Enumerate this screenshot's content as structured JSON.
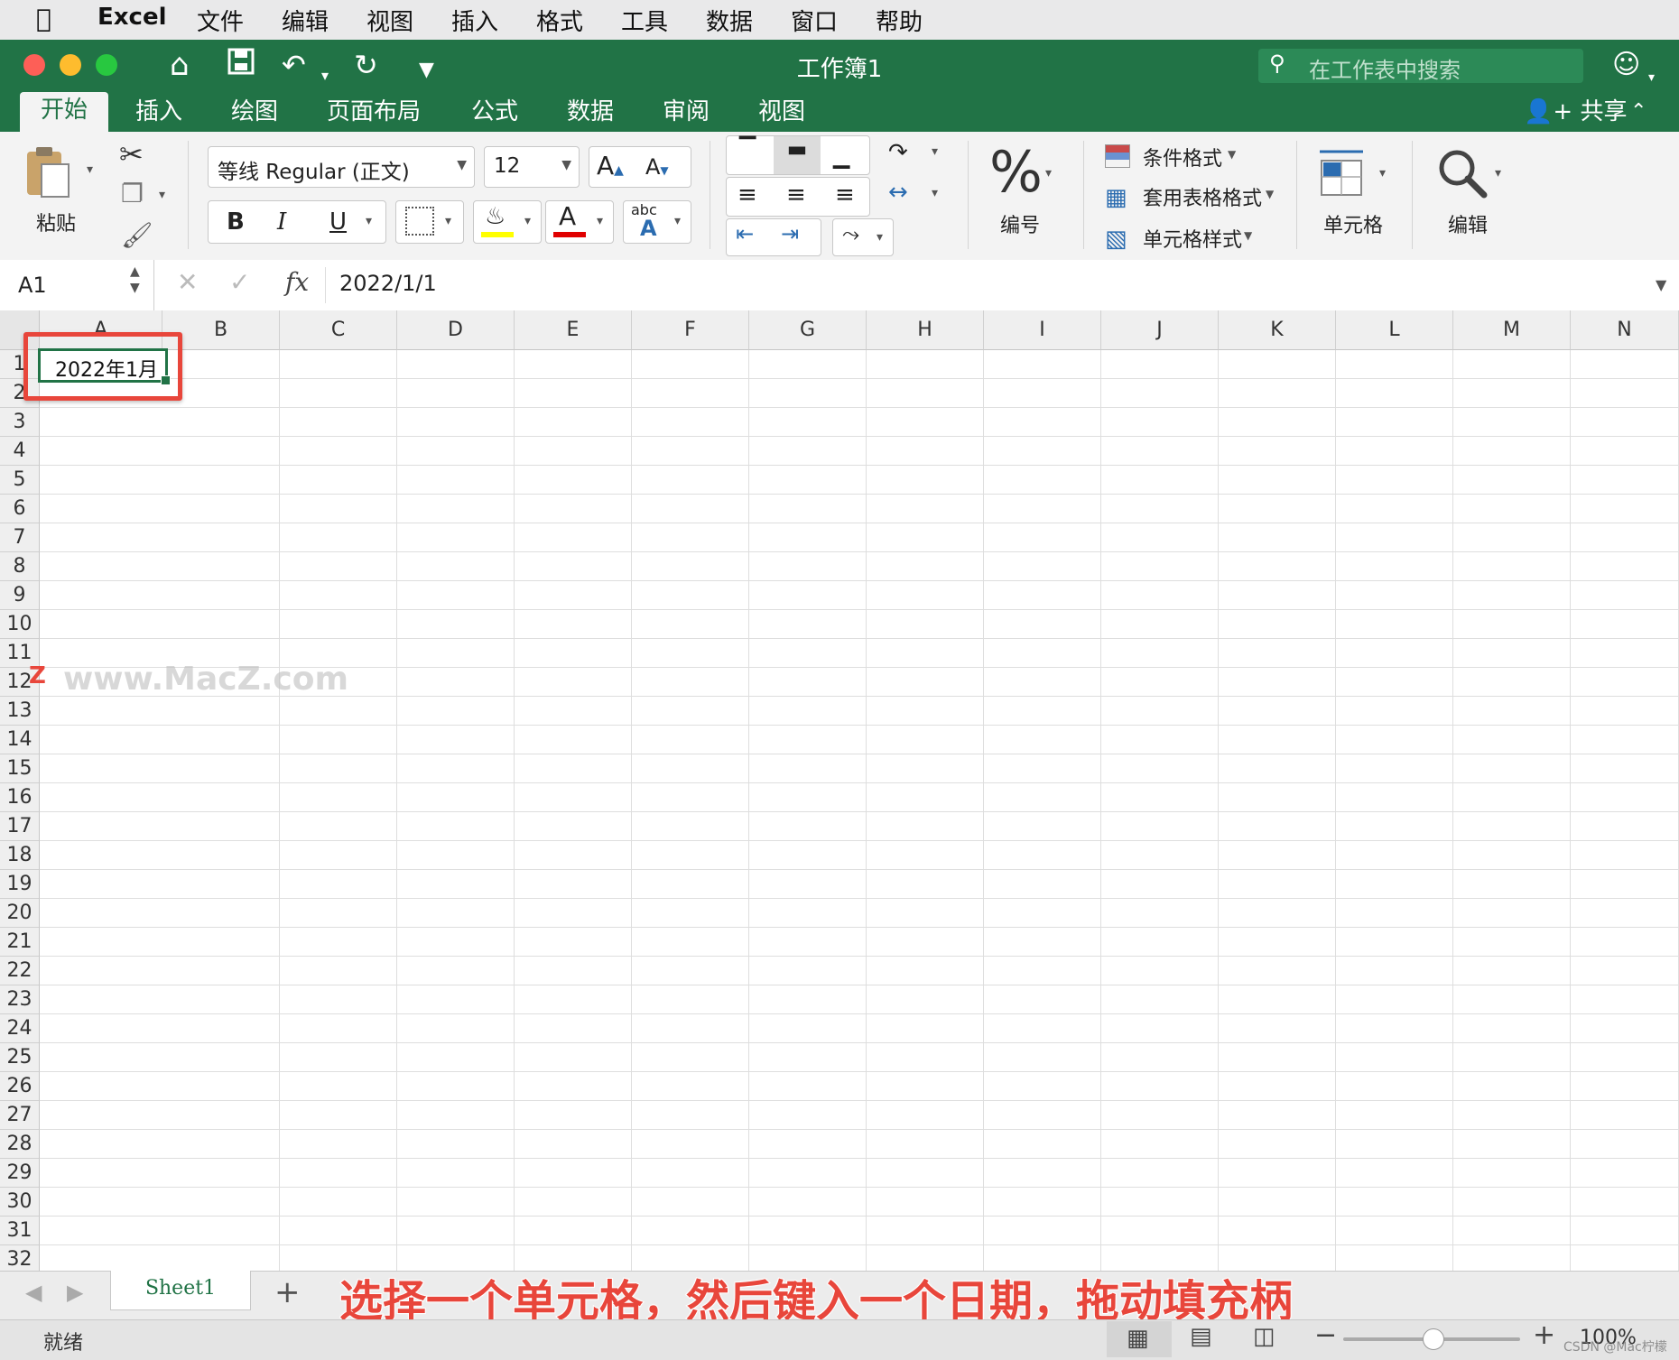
{
  "menubar": {
    "app": "Excel",
    "items": [
      "文件",
      "编辑",
      "视图",
      "插入",
      "格式",
      "工具",
      "数据",
      "窗口",
      "帮助"
    ]
  },
  "titlebar": {
    "title": "工作簿1",
    "search_placeholder": "在工作表中搜索"
  },
  "tabs": [
    "开始",
    "插入",
    "绘图",
    "页面布局",
    "公式",
    "数据",
    "审阅",
    "视图"
  ],
  "share_label": "共享",
  "ribbon": {
    "paste_label": "粘贴",
    "font_name": "等线 Regular (正文)",
    "font_size": "12",
    "bold": "B",
    "italic": "I",
    "underline": "U",
    "font_color_glyph": "A",
    "abc_label": "abc",
    "number_label": "编号",
    "percent": "%",
    "conditional_format": "条件格式",
    "format_as_table": "套用表格格式",
    "cell_styles": "单元格样式",
    "cells_label": "单元格",
    "edit_label": "编辑"
  },
  "formula_bar": {
    "name_box": "A1",
    "fx": "fx",
    "value": "2022/1/1"
  },
  "columns": [
    "A",
    "B",
    "C",
    "D",
    "E",
    "F",
    "G",
    "H",
    "I",
    "J",
    "K",
    "L",
    "M",
    "N"
  ],
  "rows": [
    "1",
    "2",
    "3",
    "4",
    "5",
    "6",
    "7",
    "8",
    "9",
    "10",
    "11",
    "12",
    "13",
    "14",
    "15",
    "16",
    "17",
    "18",
    "19",
    "20",
    "21",
    "22",
    "23",
    "24",
    "25",
    "26",
    "27",
    "28",
    "29",
    "30",
    "31",
    "32"
  ],
  "cell_a1": "2022年1月",
  "watermark": "www.MacZ.com",
  "sheet_tab": "Sheet1",
  "status": "就绪",
  "zoom": "100%",
  "caption": "选择一个单元格，然后键入一个日期，拖动填充柄",
  "credit": "CSDN @Mac柠檬",
  "colors": {
    "excel_green": "#217346",
    "highlight_red": "#e8463b"
  }
}
